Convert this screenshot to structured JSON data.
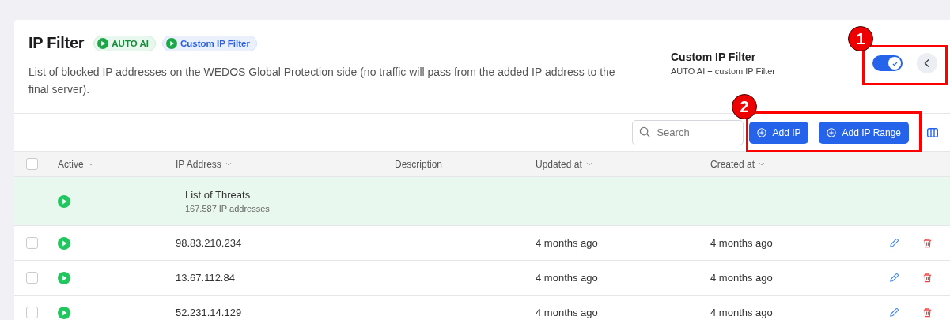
{
  "header": {
    "title": "IP Filter",
    "badges": [
      {
        "label": "AUTO AI",
        "kind": "green"
      },
      {
        "label": "Custom IP Filter",
        "kind": "blue"
      }
    ],
    "description": "List of blocked IP addresses on the WEDOS Global Protection side (no traffic will pass from the added IP address to the final server).",
    "mode_title": "Custom IP Filter",
    "mode_subtitle": "AUTO AI + custom IP Filter",
    "toggle_on": true
  },
  "toolbar": {
    "search_placeholder": "Search",
    "buttons": [
      "Add IP",
      "Add IP Range"
    ]
  },
  "table": {
    "select_all_checked": false,
    "columns": [
      {
        "label": "Active",
        "sortable": true
      },
      {
        "label": "IP Address",
        "sortable": true
      },
      {
        "label": "Description",
        "sortable": false
      },
      {
        "label": "Updated at",
        "sortable": true
      },
      {
        "label": "Created at",
        "sortable": true
      }
    ],
    "rows": [
      {
        "kind": "group",
        "active": true,
        "title": "List of Threats",
        "subtitle": "167.587 IP addresses"
      },
      {
        "kind": "ip",
        "checked": false,
        "active": true,
        "ip": "98.83.210.234",
        "updated": "4 months ago",
        "created": "4 months ago"
      },
      {
        "kind": "ip",
        "checked": false,
        "active": true,
        "ip": "13.67.112.84",
        "updated": "4 months ago",
        "created": "4 months ago"
      },
      {
        "kind": "ip",
        "checked": false,
        "active": true,
        "ip": "52.231.14.129",
        "updated": "4 months ago",
        "created": "4 months ago"
      }
    ]
  },
  "annotations": [
    {
      "number": "1"
    },
    {
      "number": "2"
    }
  ]
}
